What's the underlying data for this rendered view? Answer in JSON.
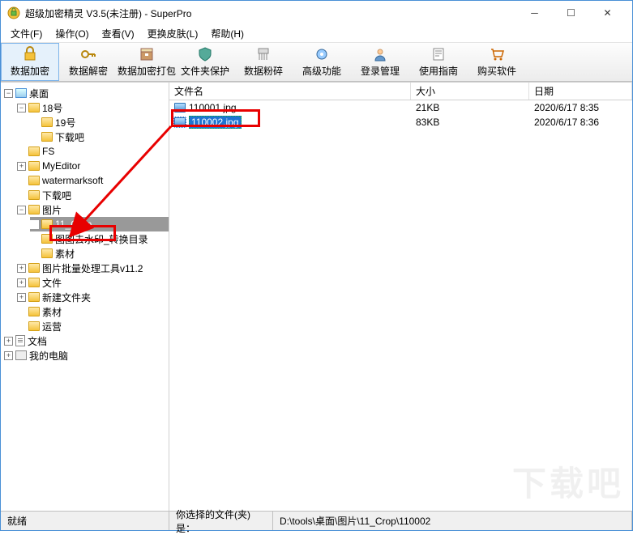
{
  "window": {
    "title": "超级加密精灵 V3.5(未注册) - SuperPro"
  },
  "menu": {
    "file": "文件(F)",
    "operate": "操作(O)",
    "view": "查看(V)",
    "skin": "更换皮肤(L)",
    "help": "帮助(H)"
  },
  "toolbar": {
    "encrypt": "数据加密",
    "decrypt": "数据解密",
    "pack": "数据加密打包",
    "protect": "文件夹保护",
    "shred": "数据粉碎",
    "advanced": "高级功能",
    "login": "登录管理",
    "guide": "使用指南",
    "buy": "购买软件"
  },
  "tree": {
    "desktop": "桌面",
    "n18": "18号",
    "n19": "19号",
    "xzb1": "下载吧",
    "fs": "FS",
    "myed": "MyEditor",
    "wm": "watermarksoft",
    "xzb2": "下载吧",
    "pic": "图片",
    "crop": "11_Crop",
    "tutu": "图图去水印_转换目录",
    "sucai1": "素材",
    "batch": "图片批量处理工具v11.2",
    "files": "文件",
    "newf": "新建文件夹",
    "sucai2": "素材",
    "ops": "运营",
    "docs": "文档",
    "mypc": "我的电脑"
  },
  "list": {
    "headers": {
      "name": "文件名",
      "size": "大小",
      "date": "日期"
    },
    "rows": [
      {
        "name": "110001.jpg",
        "size": "21KB",
        "date": "2020/6/17 8:35"
      },
      {
        "name": "110002.jpg",
        "size": "83KB",
        "date": "2020/6/17 8:36"
      }
    ]
  },
  "status": {
    "ready": "就绪",
    "label": "你选择的文件(夹)是：",
    "path": "D:\\tools\\桌面\\图片\\11_Crop\\110002"
  },
  "watermark": "下载吧"
}
